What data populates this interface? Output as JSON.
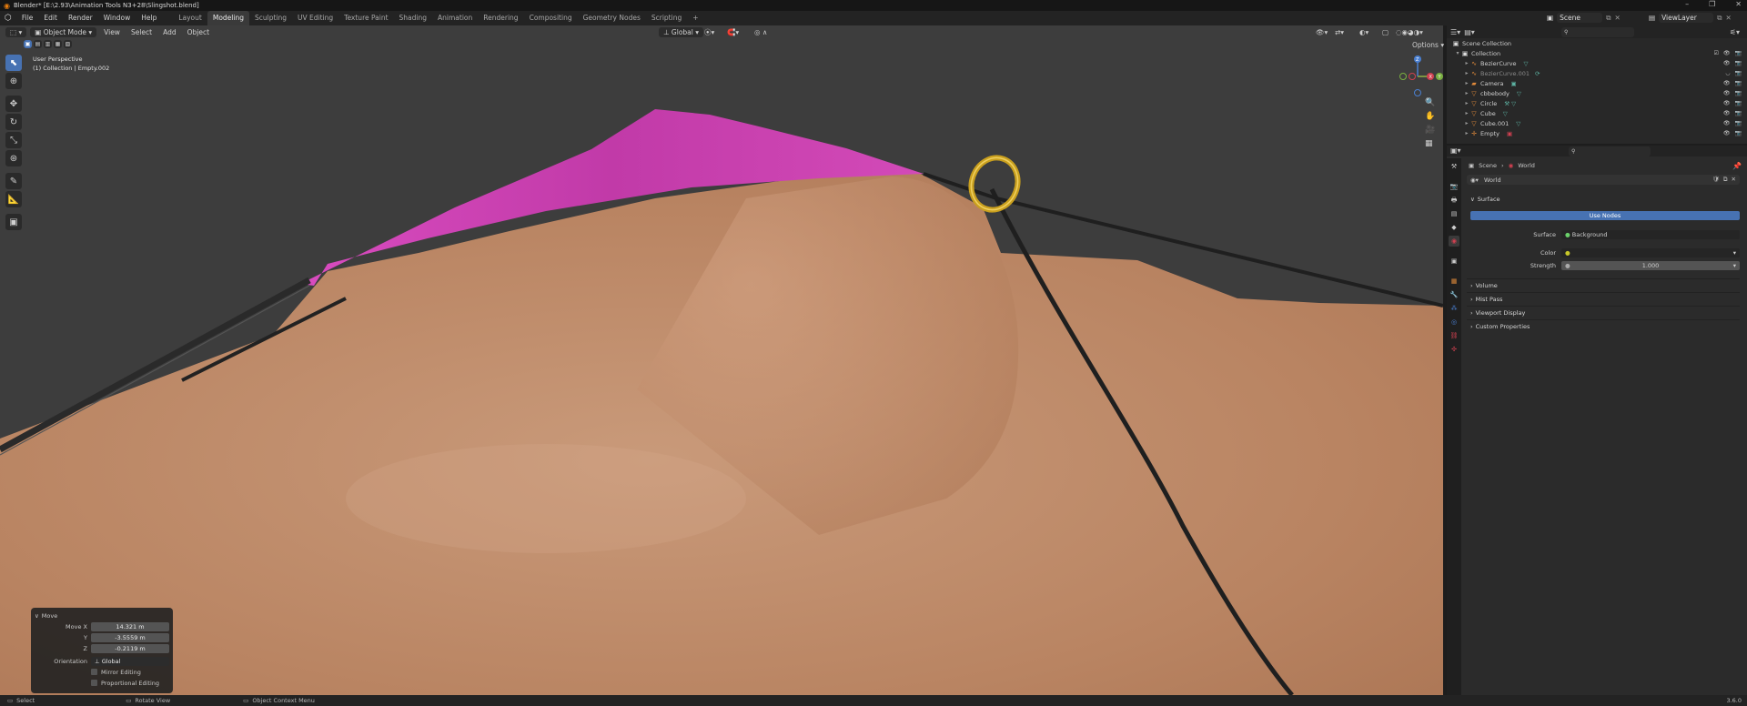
{
  "window": {
    "title": "Blender* [E:\\2.93\\Animation Tools N3+28\\Slingshot.blend]",
    "controls": [
      "–",
      "❐",
      "✕"
    ]
  },
  "menubar": {
    "menus": [
      "File",
      "Edit",
      "Render",
      "Window",
      "Help"
    ],
    "workspaces": [
      "Layout",
      "Modeling",
      "Sculpting",
      "UV Editing",
      "Texture Paint",
      "Shading",
      "Animation",
      "Rendering",
      "Compositing",
      "Geometry Nodes",
      "Scripting"
    ],
    "active_workspace": "Modeling",
    "add_tab": "+",
    "scene": "Scene",
    "view_layer": "ViewLayer"
  },
  "viewport": {
    "mode": "Object Mode",
    "menus": [
      "View",
      "Select",
      "Add",
      "Object"
    ],
    "transform_orientation": "Global",
    "options_label": "Options",
    "perspective": "User Perspective",
    "context": "(1) Collection | Empty.002",
    "gizmo": {
      "z": "Z",
      "y": "Y",
      "x": "X"
    }
  },
  "operator_panel": {
    "title": "Move",
    "fields": [
      {
        "label": "Move X",
        "value": "14.321 m"
      },
      {
        "label": "Y",
        "value": "-3.5559 m"
      },
      {
        "label": "Z",
        "value": "-0.2119 m"
      }
    ],
    "orientation_label": "Orientation",
    "orientation_value": "Global",
    "mirror_editing": "Mirror Editing",
    "proportional_editing": "Proportional Editing"
  },
  "outliner": {
    "root": "Scene Collection",
    "collection": "Collection",
    "items": [
      {
        "name": "BezierCurve",
        "icon": "curve-icon",
        "dim": false
      },
      {
        "name": "BezierCurve.001",
        "icon": "curve-icon",
        "dim": true
      },
      {
        "name": "Camera",
        "icon": "camera-icon",
        "dim": false
      },
      {
        "name": "cbbebody",
        "icon": "mesh-icon",
        "dim": false
      },
      {
        "name": "Circle",
        "icon": "mesh-icon",
        "dim": false
      },
      {
        "name": "Cube",
        "icon": "mesh-icon",
        "dim": false
      },
      {
        "name": "Cube.001",
        "icon": "mesh-icon",
        "dim": false
      },
      {
        "name": "Empty",
        "icon": "empty-icon",
        "dim": false
      }
    ]
  },
  "properties": {
    "breadcrumb_scene": "Scene",
    "breadcrumb_world": "World",
    "world_name": "World",
    "surface_panel": "Surface",
    "use_nodes_button": "Use Nodes",
    "surface_label": "Surface",
    "surface_value": "Background",
    "color_label": "Color",
    "strength_label": "Strength",
    "strength_value": "1.000",
    "collapsed_panels": [
      "Volume",
      "Mist Pass",
      "Viewport Display",
      "Custom Properties"
    ]
  },
  "statusbar": {
    "select": "Select",
    "rotate_view": "Rotate View",
    "context_menu": "Object Context Menu",
    "version": "3.6.0"
  },
  "colors": {
    "accent": "#4772b3",
    "skin": "#c08a68",
    "pink": "#d640b8",
    "ring": "#d4a520"
  }
}
